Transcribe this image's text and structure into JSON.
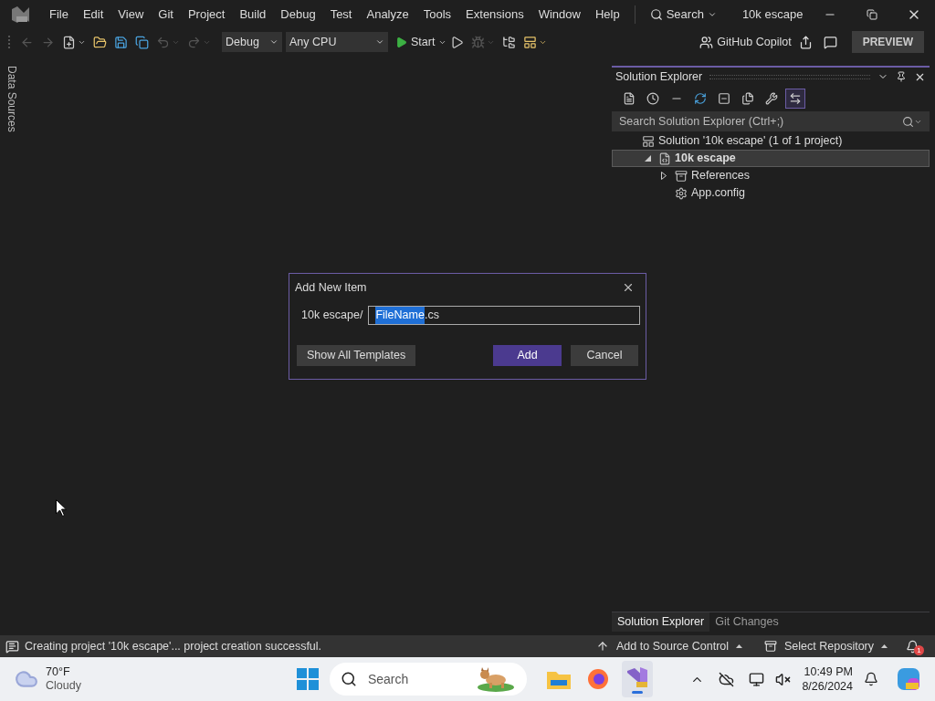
{
  "menu": [
    "File",
    "Edit",
    "View",
    "Git",
    "Project",
    "Build",
    "Debug",
    "Test",
    "Analyze",
    "Tools",
    "Extensions",
    "Window",
    "Help"
  ],
  "search": "Search",
  "window_title": "10k escape",
  "toolbar": {
    "buttons_before": [
      {
        "disabled": true,
        "dropdown": false
      },
      {
        "disabled": true,
        "dropdown": false
      },
      {
        "disabled": false,
        "dropdown": true
      },
      {
        "disabled": false,
        "dropdown": false
      },
      {
        "disabled": false,
        "dropdown": false
      },
      {
        "disabled": false,
        "dropdown": false
      },
      {
        "disabled": true,
        "dropdown": true
      },
      {
        "disabled": true,
        "dropdown": true
      }
    ],
    "configuration": "Debug",
    "platform": "Any CPU",
    "start": "Start",
    "buttons_after": [
      {
        "disabled": false,
        "dropdown": false
      },
      {
        "disabled": true,
        "dropdown": true
      },
      {
        "disabled": false,
        "dropdown": false
      },
      {
        "disabled": false,
        "dropdown": true
      }
    ],
    "copilot": "GitHub Copilot",
    "preview": "PREVIEW"
  },
  "side_tab": "Data Sources",
  "solution_explorer": {
    "title": "Solution Explorer",
    "tools": [
      {
        "selected": false
      },
      {
        "selected": false
      },
      {
        "selected": false
      },
      {
        "selected": false
      },
      {
        "selected": false
      },
      {
        "selected": false
      },
      {
        "selected": false
      },
      {
        "selected": true
      }
    ],
    "search_placeholder": "Search Solution Explorer (Ctrl+;)",
    "tree": [
      {
        "kind": "solution",
        "label": "Solution '10k escape' (1 of 1 project)",
        "selected": false,
        "children": [
          {
            "kind": "project",
            "label": "10k escape",
            "expanded": true,
            "selected": true,
            "children": [
              {
                "kind": "references",
                "label": "References",
                "expanded": false,
                "selected": false
              },
              {
                "kind": "config",
                "label": "App.config",
                "selected": false
              }
            ]
          }
        ]
      }
    ],
    "tabs": [
      {
        "label": "Solution Explorer",
        "selected": true
      },
      {
        "label": "Git Changes",
        "selected": false
      }
    ]
  },
  "dialog": {
    "title": "Add New Item",
    "path_label": "10k escape/",
    "value_parts": [
      {
        "text": "FileName",
        "selected": true
      },
      {
        "text": ".cs",
        "selected": false
      }
    ],
    "buttons": [
      {
        "kind": "secondary",
        "label": "Show All Templates"
      },
      {
        "kind": "primary",
        "label": "Add"
      },
      {
        "kind": "secondary",
        "label": "Cancel"
      }
    ]
  },
  "status_bar": {
    "message": "Creating project '10k escape'... project creation successful.",
    "source_control": "Add to Source Control",
    "repository": "Select Repository",
    "notifications": "1"
  },
  "taskbar": {
    "temperature": "70°F",
    "weather": "Cloudy",
    "search_placeholder": "Search",
    "time": "10:49 PM",
    "date": "8/26/2024"
  }
}
